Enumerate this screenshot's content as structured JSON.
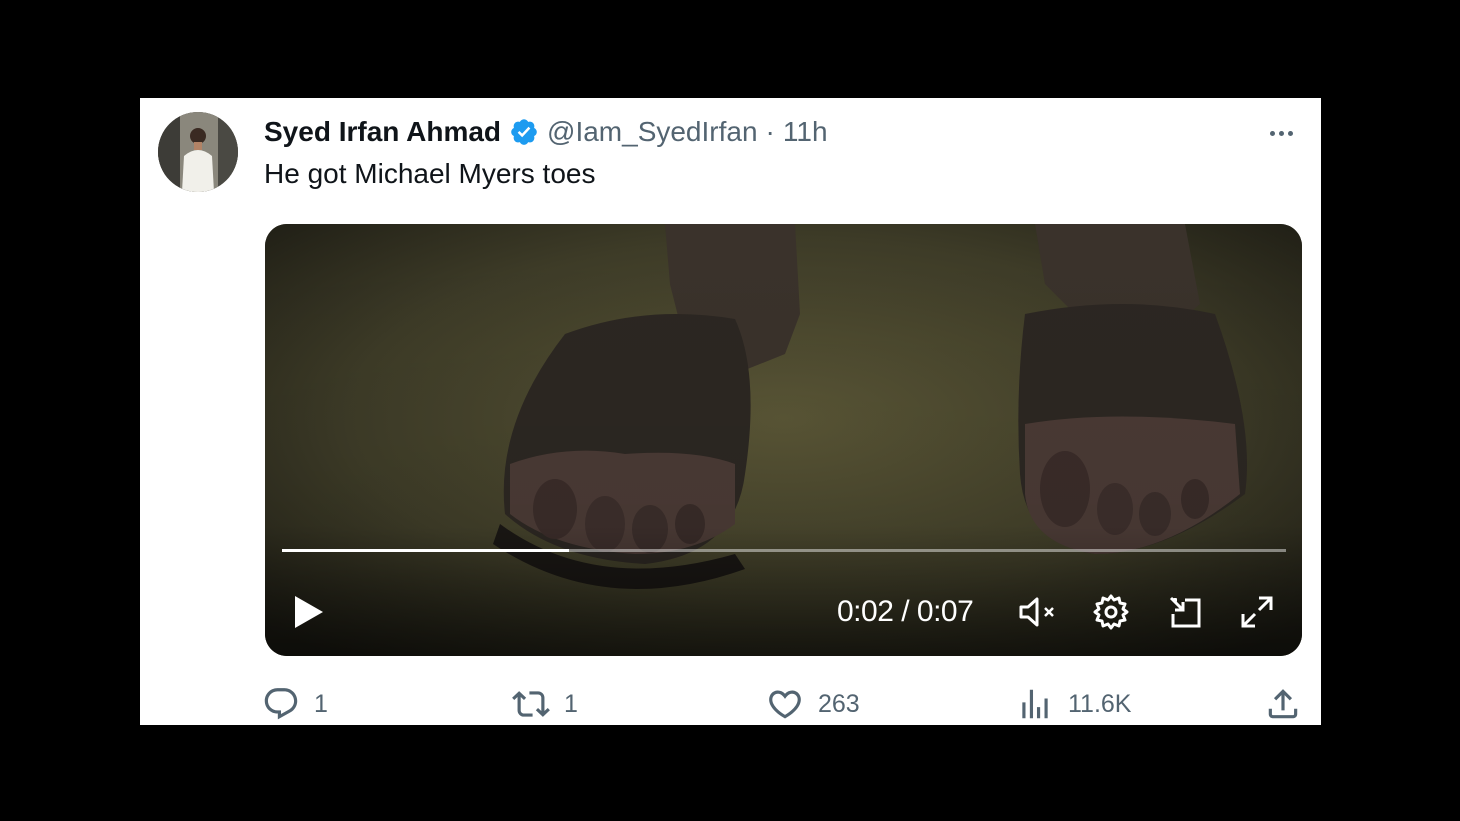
{
  "tweet": {
    "author_name": "Syed Irfan Ahmad",
    "handle": "@Iam_SyedIrfan",
    "separator": "·",
    "time_ago": "11h",
    "text": "He got Michael Myers toes",
    "verified": true,
    "verified_color": "#1d9bf0"
  },
  "video": {
    "current_time": "0:02",
    "duration": "0:07",
    "time_separator": " / ",
    "progress": 0.2857,
    "controls": [
      "play-icon",
      "mute-icon",
      "settings-icon",
      "picture-in-picture-icon",
      "fullscreen-icon"
    ]
  },
  "actions": {
    "replies": "1",
    "retweets": "1",
    "likes": "263",
    "views": "11.6K"
  },
  "colors": {
    "text_primary": "#0f1419",
    "text_secondary": "#536471",
    "background": "#ffffff",
    "page_background": "#000000"
  }
}
